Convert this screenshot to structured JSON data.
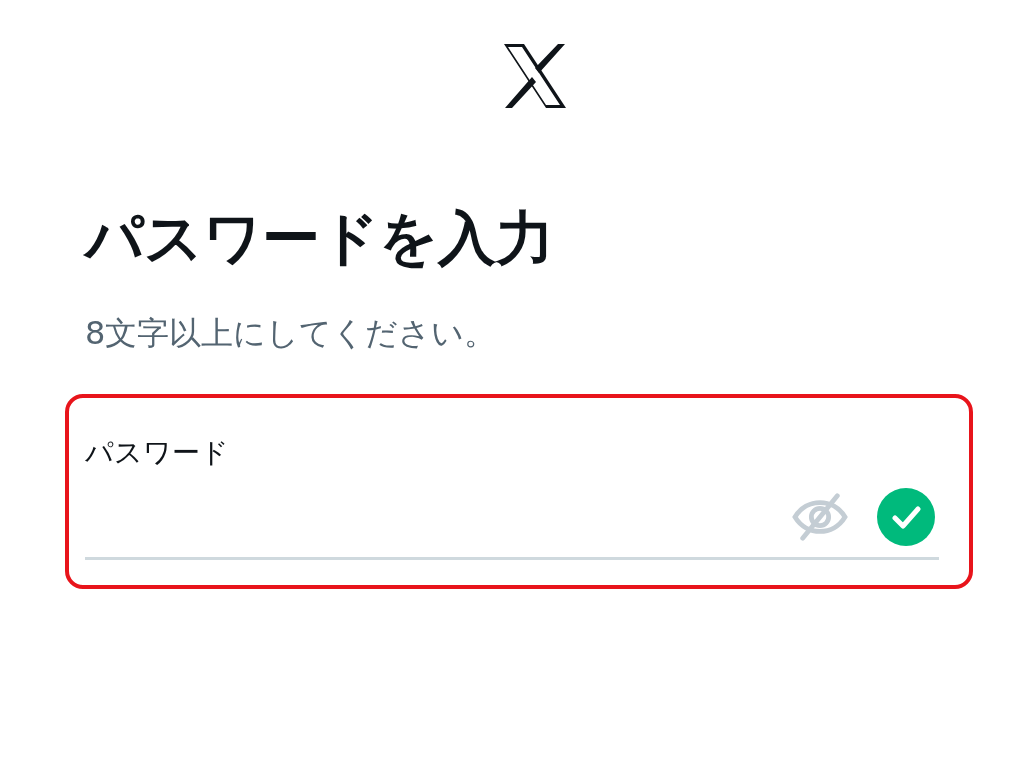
{
  "heading": "パスワードを入力",
  "subtitle": "8文字以上にしてください。",
  "password_field": {
    "label": "パスワード",
    "highlighted": true,
    "valid": true
  }
}
